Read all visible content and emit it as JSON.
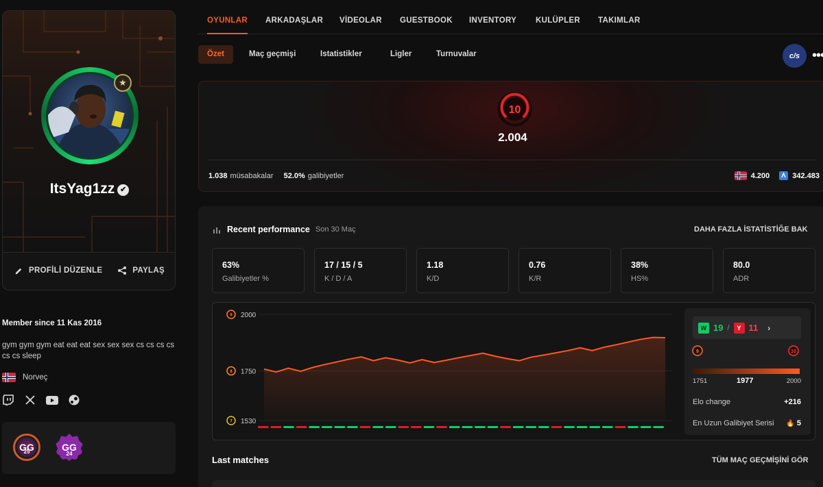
{
  "profile": {
    "username": "ItsYag1zz",
    "edit_label": "PROFİLİ DÜZENLE",
    "share_label": "PAYLAŞ",
    "member_since": "Member since 11 Kas 2016",
    "bio": "gym gym gym eat eat eat sex sex sex cs cs cs cs cs cs sleep",
    "country": "Norveç",
    "badges": [
      "GG 25",
      "GG 24"
    ],
    "badge_labels": {
      "gg25": "GG",
      "gg25_num": "25",
      "gg24": "GG",
      "gg24_num": "24"
    }
  },
  "icons": [
    "edit-icon",
    "share-icon",
    "twitch-icon",
    "x-icon",
    "youtube-icon",
    "steam-icon",
    "verified-icon",
    "chart-icon",
    "flame-icon"
  ],
  "nav": {
    "tabs": [
      "OYUNLAR",
      "ARKADAŞLAR",
      "VİDEOLAR",
      "GUESTBOOK",
      "INVENTORY",
      "KULÜPLER",
      "TAKIMLAR"
    ],
    "active": "OYUNLAR"
  },
  "subnav": {
    "tabs": [
      "Özet",
      "Maç geçmişi",
      "Istatistikler",
      "Ligler",
      "Turnuvalar"
    ],
    "active": "Özet",
    "cts_label": "c/s",
    "more_label": "•••"
  },
  "elo": {
    "level": "10",
    "value": "2.004",
    "matches": "1.038",
    "matches_label": "müsabakalar",
    "winrate": "52.0%",
    "winrate_label": "galibiyetler",
    "country_rank": "4.200",
    "global_rank": "342.483"
  },
  "performance": {
    "title": "Recent performance",
    "subtitle": "Son 30 Maç",
    "more_link": "DAHA FAZLA İSTATİSTİĞE BAK",
    "stats": [
      {
        "value": "63%",
        "label": "Galibiyetler %"
      },
      {
        "value": "17 / 15 / 5",
        "label": "K / D / A"
      },
      {
        "value": "1.18",
        "label": "K/D"
      },
      {
        "value": "0.76",
        "label": "K/R"
      },
      {
        "value": "38%",
        "label": "HS%"
      },
      {
        "value": "80.0",
        "label": "ADR"
      }
    ]
  },
  "chart_data": {
    "type": "area",
    "y_ticks": [
      "2000",
      "1750",
      "1530"
    ],
    "tick_levels": [
      "9",
      "8",
      "7"
    ],
    "ylim": [
      1530,
      2000
    ],
    "series": [
      {
        "values": [
          1758,
          1745,
          1762,
          1748,
          1765,
          1778,
          1790,
          1802,
          1812,
          1795,
          1808,
          1798,
          1785,
          1800,
          1787,
          1797,
          1808,
          1818,
          1828,
          1815,
          1804,
          1795,
          1811,
          1820,
          1830,
          1840,
          1852,
          1840,
          1855,
          1866,
          1878,
          1890,
          1898,
          1897
        ]
      }
    ],
    "results": [
      "L",
      "L",
      "W",
      "L",
      "W",
      "W",
      "W",
      "W",
      "L",
      "W",
      "W",
      "L",
      "L",
      "W",
      "L",
      "W",
      "W",
      "W",
      "W",
      "L",
      "W",
      "W",
      "W",
      "L",
      "W",
      "W",
      "W",
      "W",
      "L",
      "W",
      "W",
      "W"
    ]
  },
  "streak": {
    "wins": "19",
    "wins_tag": "W",
    "separator": "/",
    "losses": "11",
    "losses_tag": "Y",
    "level_low": "9",
    "level_high": "10",
    "range_low": "1751",
    "current": "1977",
    "range_high": "2000",
    "elo_change_label": "Elo change",
    "elo_change": "+216",
    "longest_label": "En Uzun Galibiyet Serisi",
    "longest": "5"
  },
  "matches": {
    "title": "Last matches",
    "all_link": "TÜM MAÇ GEÇMİŞİNİ GÖR"
  },
  "colors": {
    "accent": "#ff5a1f",
    "win": "#17c964",
    "loss": "#e01b2a"
  }
}
